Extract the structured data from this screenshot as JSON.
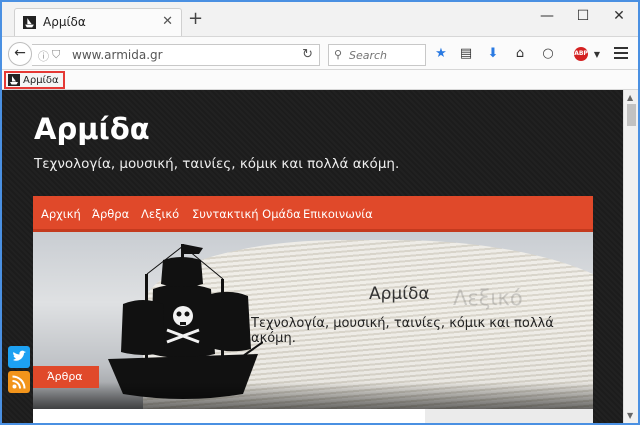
{
  "browser": {
    "tab": {
      "title": "Αρμίδα",
      "close": "✕"
    },
    "new_tab": "+",
    "window_controls": {
      "minimize": "—",
      "maximize": "☐",
      "close": "✕"
    },
    "url": "www.armida.gr",
    "search_placeholder": "Search",
    "bookmark_label": "Αρμίδα",
    "abp_label": "ABP"
  },
  "site": {
    "title": "Αρμίδα",
    "description": "Τεχνολογία, μουσική, ταινίες, κόμικ και πολλά ακόμη.",
    "nav": [
      "Αρχική",
      "Άρθρα",
      "Λεξικό",
      "Συντακτική Ομάδα",
      "Επικοινωνία"
    ],
    "hero": {
      "title": "Αρμίδα",
      "faint_word": "Λεξικό",
      "description": "Τεχνολογία, μουσική, ταινίες, κόμικ και πολλά ακόμη.",
      "badge": "Άρθρα"
    }
  },
  "colors": {
    "accent": "#e0492a",
    "twitter": "#1da1f2",
    "rss": "#f2941b"
  }
}
